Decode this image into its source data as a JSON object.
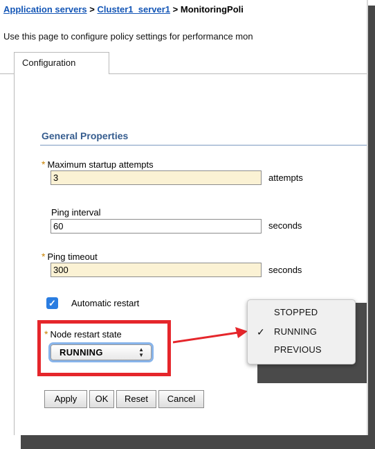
{
  "breadcrumb": {
    "items": [
      {
        "label": "Application servers",
        "link": true
      },
      {
        "label": "Cluster1_server1",
        "link": true
      },
      {
        "label": "MonitoringPoli",
        "link": false
      }
    ],
    "separator": ">"
  },
  "description": "Use this page to configure policy settings for performance mon",
  "tabs": [
    {
      "label": "Configuration",
      "active": true
    }
  ],
  "section_title": "General Properties",
  "fields": {
    "max_startup": {
      "label": "Maximum startup attempts",
      "value": "3",
      "unit": "attempts",
      "required": true
    },
    "ping_interval": {
      "label": "Ping interval",
      "value": "60",
      "unit": "seconds",
      "required": false
    },
    "ping_timeout": {
      "label": "Ping timeout",
      "value": "300",
      "unit": "seconds",
      "required": true
    }
  },
  "required_marker": "*",
  "automatic_restart": {
    "label": "Automatic restart",
    "checked": true
  },
  "node_restart": {
    "label": "Node restart state",
    "value": "RUNNING",
    "required": true
  },
  "dropdown": {
    "options": [
      "STOPPED",
      "RUNNING",
      "PREVIOUS"
    ],
    "selected": "RUNNING",
    "checkmark": "✓"
  },
  "buttons": {
    "apply": "Apply",
    "ok": "OK",
    "reset": "Reset",
    "cancel": "Cancel"
  },
  "colors": {
    "link": "#1456b6",
    "section": "#355c8e",
    "required_bg": "#fbf2d4",
    "highlight": "#e5262b",
    "checkbox": "#2a7de1"
  }
}
